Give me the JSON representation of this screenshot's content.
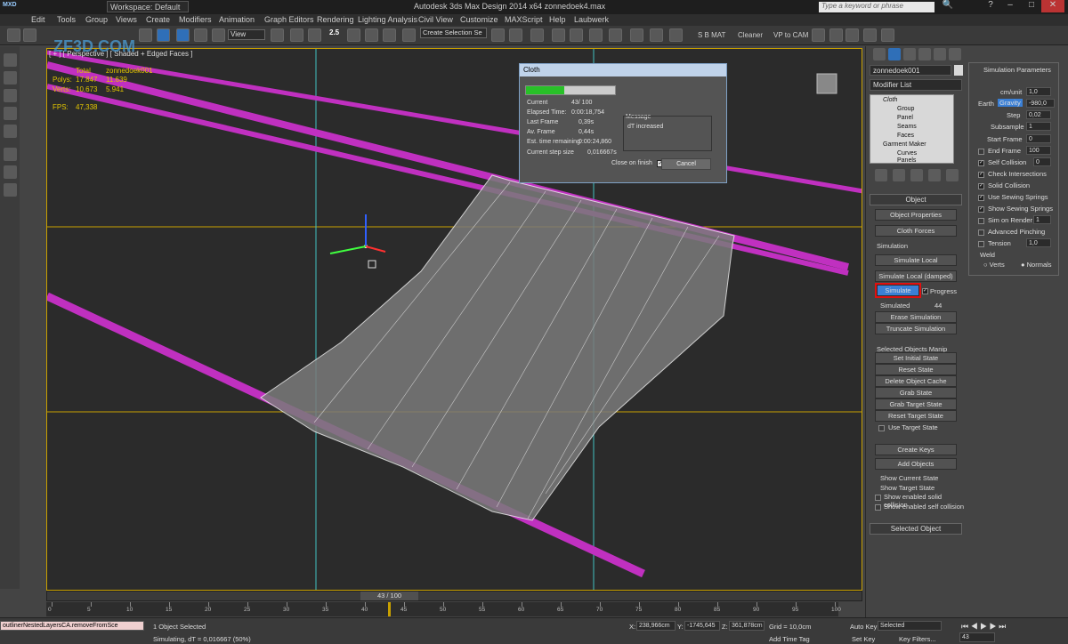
{
  "title_bar": {
    "app_title": "Autodesk 3ds Max Design 2014 x64     zonnedoek4.max",
    "workspace": "Workspace: Default",
    "search_placeholder": "Type a keyword or phrase",
    "max_logo": "MXD",
    "watermark": "ZF3D.COM"
  },
  "menus": [
    "Edit",
    "Tools",
    "Group",
    "Views",
    "Create",
    "Modifiers",
    "Animation",
    "Graph Editors",
    "Rendering",
    "Lighting Analysis",
    "Civil View",
    "Customize",
    "MAXScript",
    "Help",
    "Laubwerk"
  ],
  "toolbar": {
    "view_dropdown": "View",
    "selection_set": "Create Selection Se",
    "snap_value": "2.5",
    "sb_mat": "S B MAT",
    "cleaner": "Cleaner",
    "vp_to_cam": "VP to CAM"
  },
  "viewport": {
    "label": "[ + ] [ Perspective ] [ Shaded + Edged Faces ]",
    "stats": {
      "total_label": "Total",
      "object_name": "zonnedoek001",
      "polys_label": "Polys:",
      "polys_total": "17.847",
      "polys_obj": "11.639",
      "verts_label": "Verts:",
      "verts_total": "10.673",
      "verts_obj": "5.941",
      "fps_label": "FPS:",
      "fps_value": "47,338"
    }
  },
  "cloth_dialog": {
    "title": "Cloth",
    "progress": 0.43,
    "current_label": "Current",
    "current_value": "43/  100",
    "elapsed_label": "Elapsed Time:",
    "elapsed_value": "0:00:18,754",
    "last_frame_label": "Last Frame",
    "last_frame_value": "0,39s",
    "av_frame_label": "Av. Frame",
    "av_frame_value": "0,44s",
    "est_label": "Est. time remaining",
    "est_value": "0:00:24,860",
    "step_label": "Current step size",
    "step_value": "0,016667s",
    "message_label": "Message",
    "message_text": "dT increased",
    "close_label": "Close on finish",
    "cancel_label": "Cancel"
  },
  "command_panel": {
    "object_name": "zonnedoek001",
    "modifier_list": "Modifier List",
    "stack": [
      "Cloth",
      "Group",
      "Panel",
      "Seams",
      "Faces",
      "Garment Maker",
      "Curves",
      "Panels"
    ],
    "object_rollout": "Object",
    "object_properties": "Object Properties",
    "cloth_forces": "Cloth Forces",
    "simulation_label": "Simulation",
    "simulate_local": "Simulate Local",
    "simulate_local_damped": "Simulate Local (damped)",
    "simulate": "Simulate",
    "progress_label": "Progress",
    "simulated_label": "Simulated",
    "simulated_value": "44",
    "erase_simulation": "Erase Simulation",
    "truncate_simulation": "Truncate Simulation",
    "sel_manip_label": "Selected Objects Manip",
    "set_initial_state": "Set Initial State",
    "reset_state": "Reset State",
    "delete_object_cache": "Delete Object Cache",
    "grab_state": "Grab State",
    "grab_target_state": "Grab Target State",
    "reset_target_state": "Reset Target State",
    "use_target_state": "Use Target State",
    "create_keys": "Create Keys",
    "add_objects": "Add Objects",
    "show_current_state": "Show Current State",
    "show_target_state": "Show Target State",
    "show_solid_collision": "Show enabled solid collision",
    "show_self_collision": "Show enabled self collision",
    "selected_object_rollout": "Selected Object"
  },
  "sim_params": {
    "title": "Simulation Parameters",
    "cm_unit_label": "cm/unit",
    "cm_unit_value": "1,0",
    "earth_label": "Earth",
    "gravity_label": "Gravity",
    "gravity_value": "-980,0",
    "step_label": "Step",
    "step_value": "0,02",
    "subsample_label": "Subsample",
    "subsample_value": "1",
    "start_frame_label": "Start Frame",
    "start_frame_value": "0",
    "end_frame_label": "End Frame",
    "end_frame_value": "100",
    "self_collision_label": "Self Collision",
    "self_collision_value": "0",
    "check_intersections": "Check Intersections",
    "solid_collision": "Solid Collision",
    "use_sewing_springs": "Use Sewing Springs",
    "show_sewing_springs": "Show Sewing Springs",
    "sim_on_render_label": "Sim on Render",
    "sim_on_render_value": "1",
    "advanced_pinching": "Advanced Pinching",
    "tension_label": "Tension",
    "tension_value": "1,0",
    "weld_label": "Weld",
    "verts_label": "Verts",
    "normals_label": "Normals"
  },
  "timeline": {
    "frame_display": "43 / 100",
    "current_frame": 43,
    "ticks": [
      "0",
      "5",
      "10",
      "15",
      "20",
      "25",
      "30",
      "35",
      "40",
      "45",
      "50",
      "55",
      "60",
      "65",
      "70",
      "75",
      "80",
      "85",
      "90",
      "95",
      "100"
    ]
  },
  "status_bar": {
    "maxscript_listener": "outlinerNestedLayersCA.removeFromSce",
    "selection_status": "1 Object Selected",
    "prompt": "Simulating, dT = 0,016667 (50%)",
    "x_label": "X:",
    "x_value": "238,966cm",
    "y_label": "Y:",
    "y_value": "-1745,645",
    "z_label": "Z:",
    "z_value": "361,878cm",
    "grid": "Grid = 10,0cm",
    "add_time_tag": "Add Time Tag",
    "auto_key": "Auto Key",
    "set_key": "Set Key",
    "key_mode": "Selected",
    "key_filters": "Key Filters...",
    "frame_field": "43"
  }
}
